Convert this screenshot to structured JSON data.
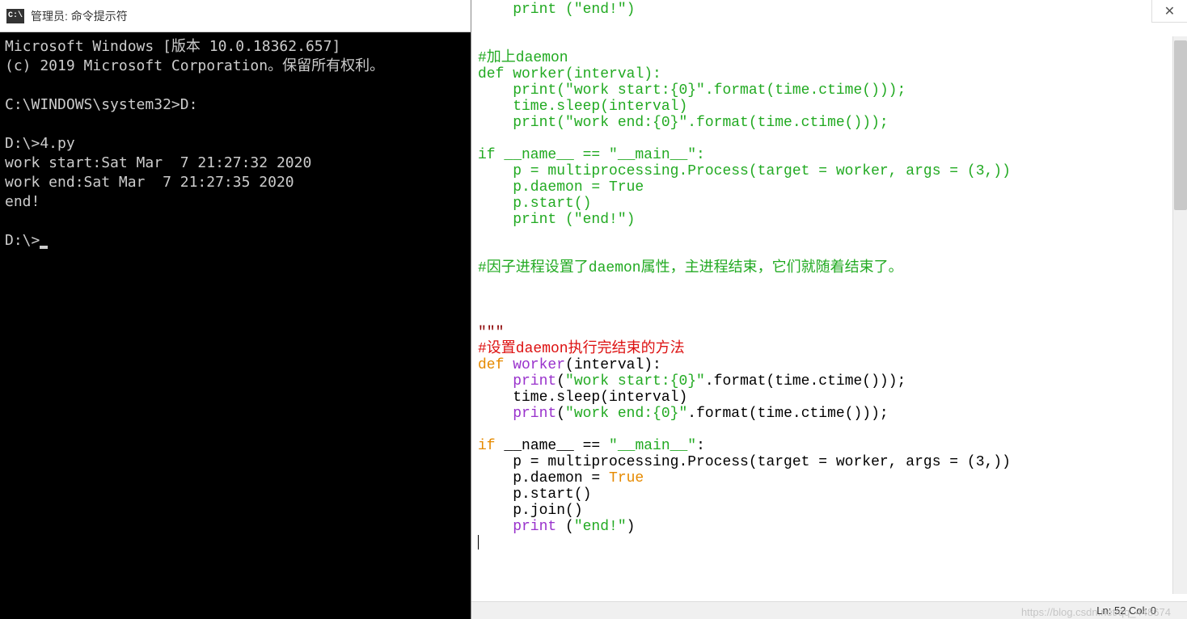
{
  "terminal": {
    "icon_label": "C:\\",
    "title": "管理员: 命令提示符",
    "lines": {
      "l1": "Microsoft Windows [版本 10.0.18362.657]",
      "l2": "(c) 2019 Microsoft Corporation。保留所有权利。",
      "l3": "",
      "l4": "C:\\WINDOWS\\system32>D:",
      "l5": "",
      "l6": "D:\\>4.py",
      "l7": "work start:Sat Mar  7 21:27:32 2020",
      "l8": "work end:Sat Mar  7 21:27:35 2020",
      "l9": "end!",
      "l10": "",
      "l11": "D:\\>"
    }
  },
  "editor": {
    "close_symbol": "✕",
    "status": "Ln: 52  Col: 0",
    "code": {
      "a1": "    print (\"end!\")",
      "a2": "",
      "a3": "",
      "a4": "#加上daemon",
      "a5a": "def ",
      "a5b": "worker(interval):",
      "a6": "    print(\"work start:{0}\".format(time.ctime()));",
      "a7": "    time.sleep(interval)",
      "a8": "    print(\"work end:{0}\".format(time.ctime()));",
      "a9": "",
      "a10": "if __name__ == \"__main__\":",
      "a11": "    p = multiprocessing.Process(target = worker, args = (3,))",
      "a12": "    p.daemon = True",
      "a13": "    p.start()",
      "a14": "    print (\"end!\")",
      "a15": "",
      "a16": "",
      "a17": "#因子进程设置了daemon属性，主进程结束，它们就随着结束了。",
      "a18": "",
      "a19": "",
      "a20": "",
      "a21": "\"\"\"",
      "a22": "#设置daemon执行完结束的方法",
      "b1a": "def",
      "b1b": " worker",
      "b1c": "(interval):",
      "b2a": "    print",
      "b2b": "(",
      "b2c": "\"work start:{0}\"",
      "b2d": ".format(time.ctime()));",
      "b3": "    time.sleep(interval)",
      "b4a": "    print",
      "b4b": "(",
      "b4c": "\"work end:{0}\"",
      "b4d": ".format(time.ctime()));",
      "b5": "",
      "b6a": "if",
      "b6b": " __name__ == ",
      "b6c": "\"__main__\"",
      "b6d": ":",
      "b7": "    p = multiprocessing.Process(target = worker, args = (3,))",
      "b8a": "    p.daemon = ",
      "b8b": "True",
      "b9": "    p.start()",
      "b10": "    p.join()",
      "b11a": "    print",
      "b11b": " (",
      "b11c": "\"end!\"",
      "b11d": ")"
    }
  },
  "watermark": "https://blog.csdn.net/qq_448674"
}
